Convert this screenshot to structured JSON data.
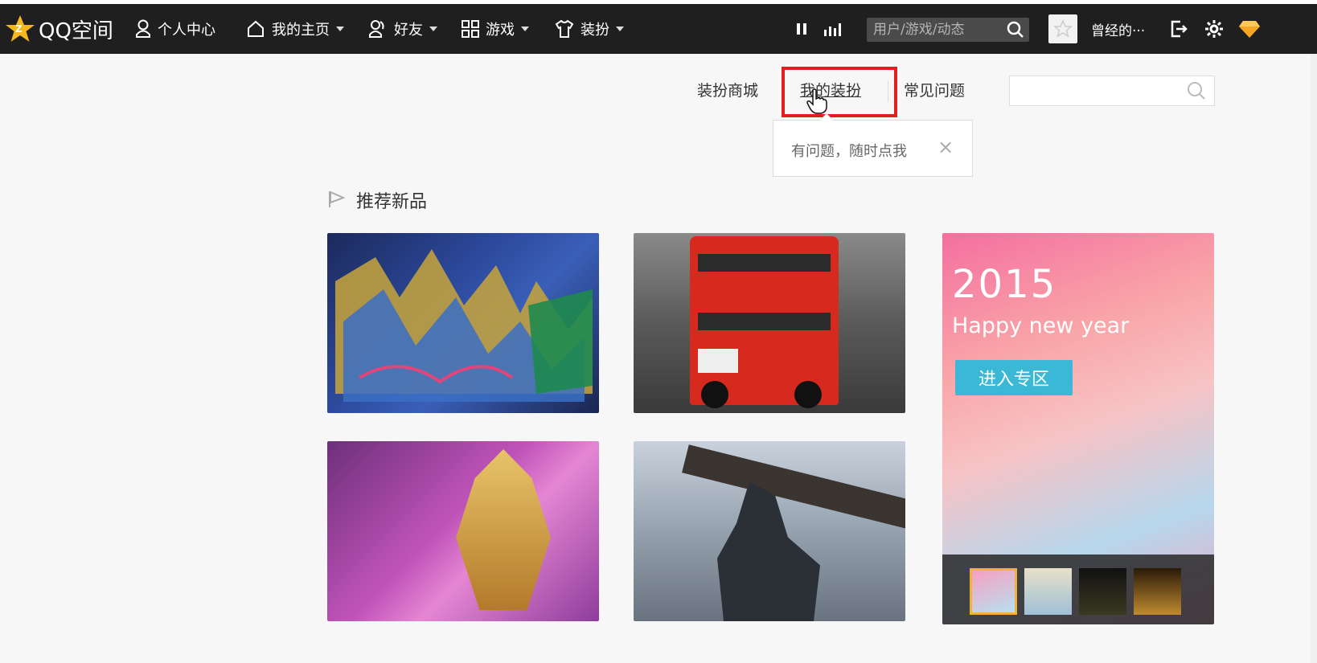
{
  "navbar": {
    "logo_text": "QQ空间",
    "items": [
      {
        "label": "个人中心",
        "icon": "person-icon"
      },
      {
        "label": "我的主页",
        "icon": "home-icon"
      },
      {
        "label": "好友",
        "icon": "friends-icon"
      },
      {
        "label": "游戏",
        "icon": "grid-icon"
      },
      {
        "label": "装扮",
        "icon": "shirt-icon"
      }
    ],
    "search_placeholder": "用户/游戏/动态",
    "username": "曾经的···"
  },
  "subnav": {
    "links": [
      "装扮商城",
      "我的装扮",
      "常见问题"
    ],
    "active_index": 1
  },
  "tooltip": {
    "text": "有问题，随时点我",
    "close_glyph": "×"
  },
  "section": {
    "title": "推荐新品"
  },
  "tiles": {
    "promo": {
      "year": "2015",
      "message": "Happy new year",
      "button": "进入专区"
    }
  },
  "colors": {
    "navbar_bg": "#1f1f1f",
    "highlight": "#e02020",
    "promo_button": "#3ab8d6"
  }
}
